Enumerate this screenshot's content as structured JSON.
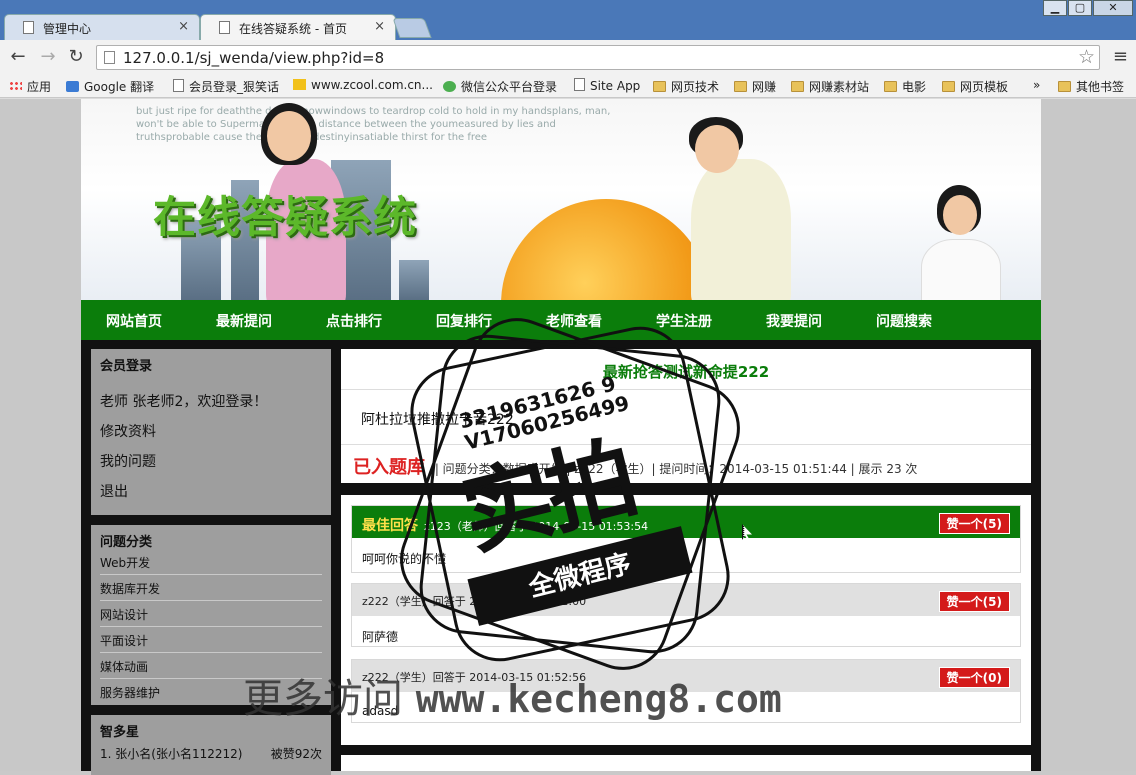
{
  "browser": {
    "tabs": [
      {
        "label": "管理中心",
        "active": false
      },
      {
        "label": "在线答疑系统 - 首页",
        "active": true
      }
    ],
    "url": "127.0.0.1/sj_wenda/view.php?id=8",
    "bookmarks": [
      {
        "label": "应用",
        "icon": "apps-icon"
      },
      {
        "label": "Google 翻译",
        "icon": "google-translate-icon"
      },
      {
        "label": "会员登录_狠笑话",
        "icon": "page-icon"
      },
      {
        "label": "www.zcool.com.cn...",
        "icon": "zcool-icon"
      },
      {
        "label": "微信公众平台登录",
        "icon": "wechat-icon"
      },
      {
        "label": "Site App",
        "icon": "page-icon"
      },
      {
        "label": "网页技术",
        "icon": "folder-icon"
      },
      {
        "label": "网赚",
        "icon": "folder-icon"
      },
      {
        "label": "网赚素材站",
        "icon": "folder-icon"
      },
      {
        "label": "电影",
        "icon": "folder-icon"
      },
      {
        "label": "网页模板",
        "icon": "folder-icon"
      },
      {
        "label": "»",
        "icon": ""
      },
      {
        "label": "其他书签",
        "icon": "folder-icon"
      }
    ]
  },
  "banner": {
    "logo": "在线答疑系统",
    "bg_text": "but just ripe for deaththe desertsnowwindows to teardrop cold to hold in my handsplans, man, won't be able to Supermanlove: the distance between the youmeasured by lies and truthsprobable cause the time and destinyinsatiable thirst for the free"
  },
  "nav": [
    "网站首页",
    "最新提问",
    "点击排行",
    "回复排行",
    "老师查看",
    "学生注册",
    "我要提问",
    "问题搜索"
  ],
  "login": {
    "title": "会员登录",
    "welcome": "老师 张老师2，欢迎登录！",
    "links": [
      "修改资料",
      "我的问题",
      "退出"
    ]
  },
  "categories": {
    "title": "问题分类",
    "items": [
      "Web开发",
      "数据库开发",
      "网站设计",
      "平面设计",
      "媒体动画",
      "服务器维护"
    ]
  },
  "ranking": {
    "title": "智多星",
    "items": [
      {
        "label": "1. 张小名(张小名112212)",
        "count": "被赞92次"
      }
    ]
  },
  "question": {
    "title": "最新抢答测试新命提222",
    "body": "阿杜拉垃推撒拉卡音222",
    "badge": "已入题库",
    "meta": "| 问题分类：数据库开发 | z222（学生）| 提问时间：2014-03-15 01:51:44 | 展示 23 次"
  },
  "answers": [
    {
      "best_label": "最佳回答",
      "header": "z123（老师）回答于 2014-03-15 01:53:54",
      "like": "赞一个(5)",
      "body": "呵呵你说的不懂"
    },
    {
      "best_label": "",
      "header": "z222（学生）回答于 2014-03-15 01:52:00",
      "like": "赞一个(5)",
      "body": "阿萨德"
    },
    {
      "best_label": "",
      "header": "z222（学生）回答于 2014-03-15 01:52:56",
      "like": "赞一个(0)",
      "body": "adasd"
    }
  ],
  "overlay": {
    "stamp_numbers": "3219631626 9\nV17060256499",
    "stamp_big": "实拍",
    "stamp_ribbon": "全微程序",
    "watermark_cn": "更多访问",
    "watermark_url": "www.kecheng8.com"
  },
  "colors": {
    "nav_green": "#0b7d0b",
    "like_red": "#d41a1a",
    "badge_red": "#dd2222"
  }
}
